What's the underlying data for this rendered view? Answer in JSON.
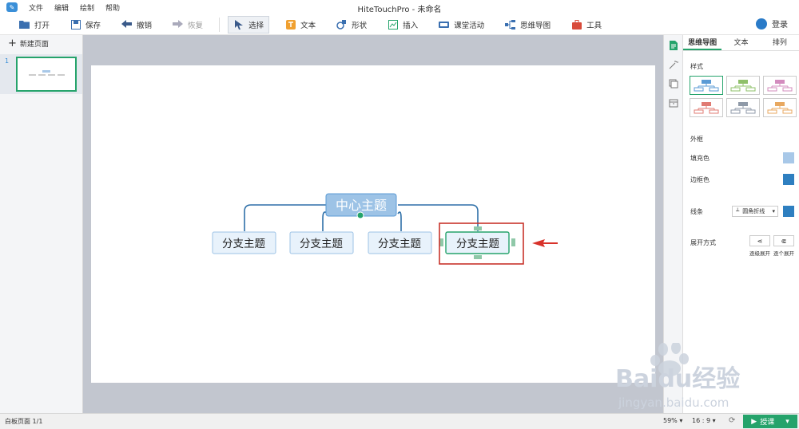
{
  "menubar": {
    "items": [
      "文件",
      "编辑",
      "绘制",
      "帮助"
    ],
    "title": "HiteTouchPro - 未命名",
    "login": "登录"
  },
  "toolbar": {
    "open": "打开",
    "save": "保存",
    "undo": "撤销",
    "redo": "恢复",
    "select": "选择",
    "text": "文本",
    "shape": "形状",
    "insert": "插入",
    "class_activity": "课堂活动",
    "mindmap": "思维导图",
    "tools": "工具"
  },
  "left_panel": {
    "new_page": "新建页面",
    "page_number": "1"
  },
  "mindmap": {
    "center": "中心主题",
    "branches": [
      "分支主题",
      "分支主题",
      "分支主题",
      "分支主题"
    ],
    "selected_branch": 3
  },
  "right_panel": {
    "tabs": [
      "思维导图",
      "文本",
      "排列"
    ],
    "active_tab": 0,
    "style_label": "样式",
    "style_colors": [
      "#5b9bd5",
      "#8fc06a",
      "#d38cbe",
      "#e07b73",
      "#8f9aa8",
      "#e8a860"
    ],
    "border_section": "外框",
    "fill_label": "填充色",
    "fill_color": "#a8c8e8",
    "border_label": "边框色",
    "border_color": "#2e7fc0",
    "line_label": "线条",
    "line_style": "圆角折线",
    "line_color": "#2e7fc0",
    "expand_label": "展开方式",
    "expand_level": "逐级展开",
    "expand_each": "逐个展开"
  },
  "statusbar": {
    "page": "白板页面 1/1",
    "zoom": "59%",
    "ratio": "16 : 9",
    "present": "授课"
  },
  "watermark": {
    "brand": "Baidu经验",
    "url": "jingyan.baidu.com"
  }
}
